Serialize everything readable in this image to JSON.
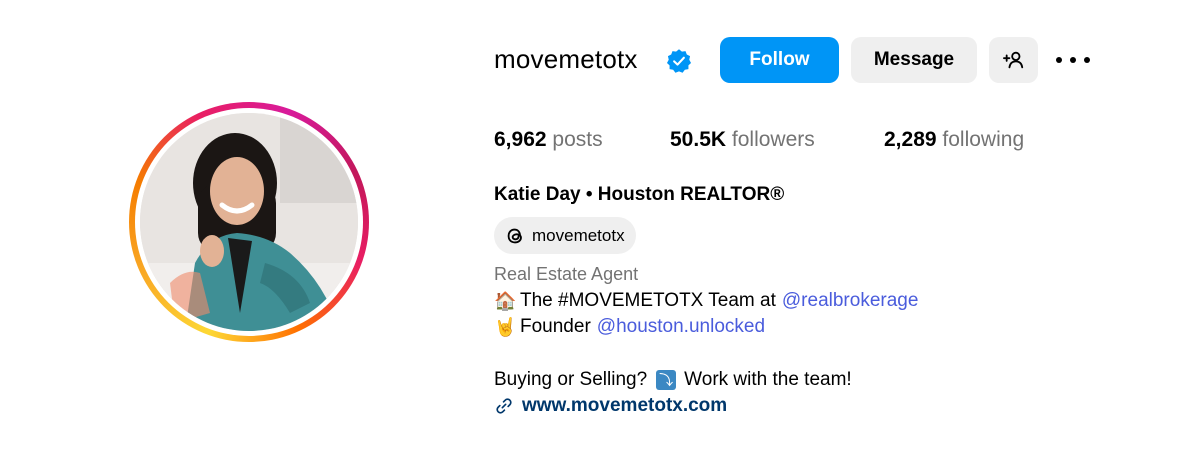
{
  "profile": {
    "username": "movemetotx",
    "verified": true,
    "buttons": {
      "follow": "Follow",
      "message": "Message"
    },
    "stats": {
      "posts_count": "6,962",
      "posts_label": "posts",
      "followers_count": "50.5K",
      "followers_label": "followers",
      "following_count": "2,289",
      "following_label": "following"
    },
    "full_name": "Katie Day • Houston REALTOR®",
    "threads_handle": "movemetotx",
    "category": "Real Estate Agent",
    "bio": {
      "line1_emoji": "🏠",
      "line1_text": "The #MOVEMETOTX Team at",
      "line1_mention": "@realbrokerage",
      "line2_emoji": "🤘",
      "line2_text": "Founder",
      "line2_mention": "@houston.unlocked",
      "line3_text_a": "Buying or Selling?",
      "line3_arrow": "⤵",
      "line3_text_b": "Work with the team!"
    },
    "website": "www.movemetotx.com"
  },
  "colors": {
    "follow_button": "#0095f6",
    "secondary_button": "#efefef",
    "link": "#00376b",
    "mention": "#4a5cdc",
    "muted_text": "#737373",
    "verified_badge": "#0095f6"
  },
  "icons": [
    "verified-badge-icon",
    "add-user-icon",
    "more-options-icon",
    "threads-icon",
    "link-icon"
  ]
}
